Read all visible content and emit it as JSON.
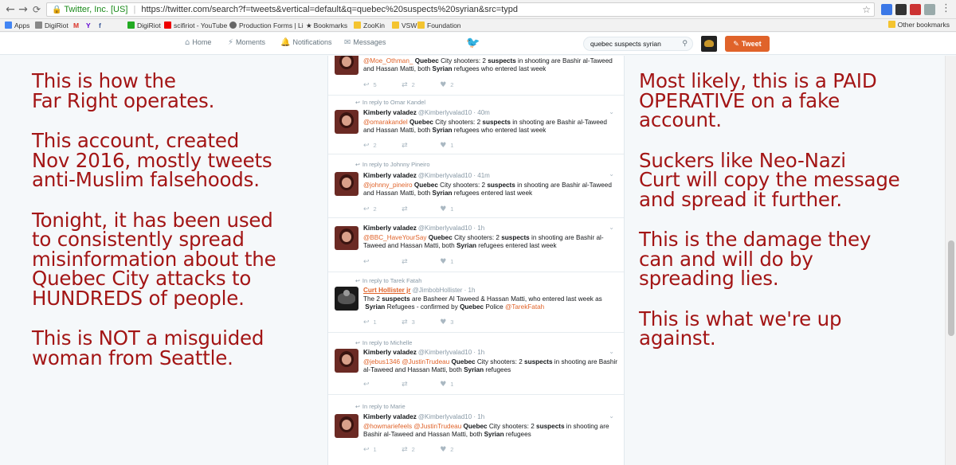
{
  "browser": {
    "back_icon": "back-arrow-icon",
    "forward_icon": "forward-arrow-icon",
    "reload_icon": "reload-icon",
    "home_icon": "home-icon",
    "secure_label": "Twitter, Inc. [US]",
    "url": "https://twitter.com/search?f=tweets&vertical=default&q=quebec%20suspects%20syrian&src=typd",
    "bookmarks": [
      "Apps",
      "DigiRiot",
      "M",
      "Y",
      "f",
      "DigiRiot",
      "scifiriot - YouTube",
      "Production Forms | Li",
      "Bookmarks",
      "ZooKin",
      "VSW",
      "Foundation"
    ],
    "other_bookmarks": "Other bookmarks"
  },
  "twitter_nav": {
    "home": "Home",
    "moments": "Moments",
    "notifications": "Notifications",
    "messages": "Messages",
    "search_value": "quebec suspects syrian",
    "tweet_button": "Tweet"
  },
  "annotations_left": [
    "This is how the\nFar Right operates.",
    "This account, created\nNov 2016, mostly tweets\nanti-Muslim falsehoods.",
    "Tonight, it has been used\nto consistently spread\nmisinformation about the\nQuebec City attacks to\nHUNDREDS of people.",
    "This is NOT a misguided\nwoman from Seattle."
  ],
  "annotations_right": [
    "Most likely, this is a PAID\nOPERATIVE on a fake\naccount.",
    "Suckers like Neo-Nazi\nCurt will copy the message\nand spread it further.",
    "This is the damage they\ncan and will do by\nspreading lies.",
    "This is what we're up\nagainst."
  ],
  "tweets": [
    {
      "reply_to": "",
      "name": "",
      "handle": "",
      "time": "",
      "mention": "@Moe_Othman_",
      "text_html": " <b>Quebec</b> City shooters: 2 <b>suspects</b> in shooting are Bashir al-Taweed and Hassan Matti, both <b>Syrian</b> refugees who entered last week",
      "replies": "5",
      "retweets": "2",
      "likes": "2"
    },
    {
      "reply_to": "In reply to Omar Kandel",
      "name": "Kimberly valadez",
      "handle": "@Kimberlyvalad10 · 40m",
      "time": "",
      "mention": "@omarakandel",
      "text_html": " <b>Quebec</b> City shooters: 2 <b>suspects</b> in shooting are Bashir al-Taweed and Hassan Matti, both <b>Syrian</b> refugees who entered last week",
      "replies": "2",
      "retweets": "",
      "likes": "1"
    },
    {
      "reply_to": "In reply to Johnny Pineiro",
      "name": "Kimberly valadez",
      "handle": "@Kimberlyvalad10 · 41m",
      "time": "",
      "mention": "@johnny_pineiro",
      "text_html": " <b>Quebec</b> City shooters: 2 <b>suspects</b> in shooting are Bashir al-Taweed and Hassan Matti, both <b>Syrian</b> refugees entered last week",
      "replies": "2",
      "retweets": "",
      "likes": "1"
    },
    {
      "reply_to": "",
      "name": "Kimberly valadez",
      "handle": "@Kimberlyvalad10 · 1h",
      "time": "",
      "mention": "@BBC_HaveYourSay",
      "text_html": " <b>Quebec</b> City shooters: 2 <b>suspects</b> in shooting are Bashir al-Taweed and Hassan Matti, both <b>Syrian</b> refugees entered last week",
      "replies": "",
      "retweets": "",
      "likes": "1"
    },
    {
      "reply_to": "In reply to Tarek Fatah",
      "name": "Curt Hollister jr",
      "handle": "@JimbobHollister · 1h",
      "time": "",
      "mention": "",
      "text_html": "The 2 <b>suspects</b> are Basheer Al Taweed &amp; Hassan Matti, who entered last week as &nbsp;<b>Syrian</b> Refugees - confirmed by <b>Quebec</b> Police <span class=\"mention\">@TarekFatah</span>",
      "replies": "1",
      "retweets": "3",
      "likes": "3"
    },
    {
      "reply_to": "In reply to Michelle",
      "name": "Kimberly valadez",
      "handle": "@Kimberlyvalad10 · 1h",
      "time": "",
      "mention": "@jebus1346 @JustinTrudeau",
      "text_html": " <b>Quebec</b> City shooters: 2 <b>suspects</b> in shooting are Bashir al-Taweed and Hassan Matti, both <b>Syrian</b> refugees",
      "replies": "",
      "retweets": "",
      "likes": "1"
    },
    {
      "reply_to": "In reply to Marie",
      "name": "Kimberly valadez",
      "handle": "@Kimberlyvalad10 · 1h",
      "time": "",
      "mention": "@howmariefeels @JustinTrudeau",
      "text_html": " <b>Quebec</b> City shooters: 2 <b>suspects</b> in shooting are Bashir al-Taweed and Hassan Matti, both <b>Syrian</b> refugees",
      "replies": "1",
      "retweets": "2",
      "likes": "2"
    }
  ],
  "colors": {
    "annotation_red": "#a31515",
    "twitter_blue": "#1da1f2",
    "accent_orange": "#e0632a"
  }
}
